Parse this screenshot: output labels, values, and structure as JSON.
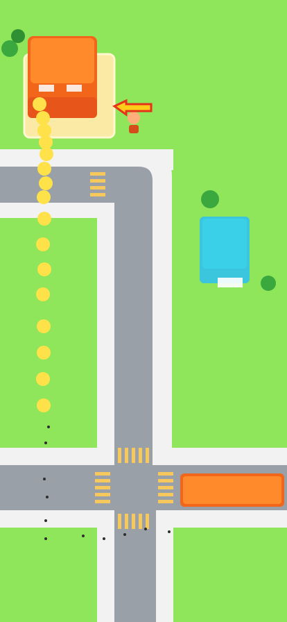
{
  "game": {
    "colors": {
      "grass": "#8fe65a",
      "sidewalk": "#f2f2f2",
      "road": "#9aa0a8",
      "crosswalk": "#f7c85c",
      "truck": "#f2661b",
      "truck_roof": "#ff8a2c",
      "house": "#3cc6de",
      "house_roof": "#3ad0e8",
      "tree": "#3aa83e",
      "crowd": "#ffe24a",
      "crowd_shadow": "#d8b61a",
      "arrow": "#ffcc1a",
      "arrow_outline": "#e5331b",
      "zone": "#fbe9a6"
    },
    "entities": {
      "truck_top": "orange-truck",
      "truck_right": "orange-bus",
      "house": "blue-house",
      "leader": "leader-character",
      "crowd": "follower-crowd",
      "direction_arrow": "direction-arrow"
    }
  }
}
